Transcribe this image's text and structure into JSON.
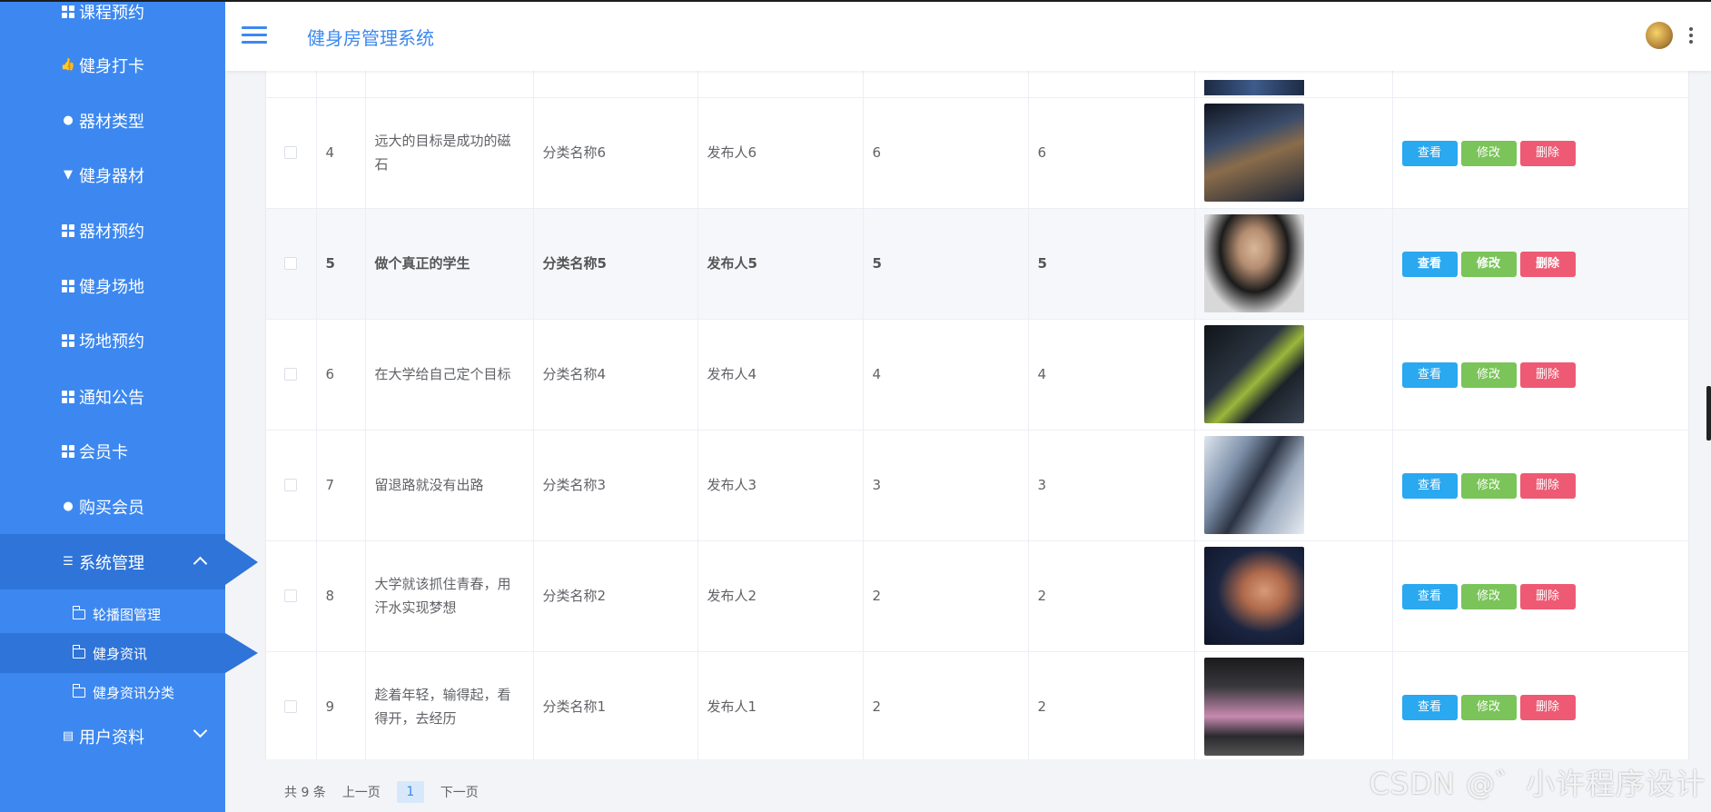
{
  "sidebar": {
    "items": [
      {
        "label": "课程预约",
        "icon": "grid-icon"
      },
      {
        "label": "健身打卡",
        "icon": "thumb-icon"
      },
      {
        "label": "器材类型",
        "icon": "bulb-icon"
      },
      {
        "label": "健身器材",
        "icon": "pin-icon"
      },
      {
        "label": "器材预约",
        "icon": "grid-icon"
      },
      {
        "label": "健身场地",
        "icon": "grid-icon"
      },
      {
        "label": "场地预约",
        "icon": "grid-icon"
      },
      {
        "label": "通知公告",
        "icon": "grid-icon"
      },
      {
        "label": "会员卡",
        "icon": "grid-icon"
      },
      {
        "label": "购买会员",
        "icon": "user-icon"
      },
      {
        "label": "系统管理",
        "icon": "list-icon"
      },
      {
        "label": "用户资料",
        "icon": "card-icon"
      }
    ],
    "sub_items": [
      {
        "label": "轮播图管理",
        "icon": "folder-icon"
      },
      {
        "label": "健身资讯",
        "icon": "folder-icon"
      },
      {
        "label": "健身资讯分类",
        "icon": "folder-icon"
      }
    ]
  },
  "header": {
    "title": "健身房管理系统",
    "menu_icon": "hamburger-icon",
    "avatar_icon": "avatar",
    "more_icon": "more-vertical-icon"
  },
  "table": {
    "rows": [
      {
        "id": "4",
        "title": "远大的目标是成功的磁石",
        "category": "分类名称6",
        "publisher": "发布人6",
        "col5": "6",
        "col6": "6"
      },
      {
        "id": "5",
        "title": "做个真正的学生",
        "category": "分类名称5",
        "publisher": "发布人5",
        "col5": "5",
        "col6": "5"
      },
      {
        "id": "6",
        "title": "在大学给自己定个目标",
        "category": "分类名称4",
        "publisher": "发布人4",
        "col5": "4",
        "col6": "4"
      },
      {
        "id": "7",
        "title": "留退路就没有出路",
        "category": "分类名称3",
        "publisher": "发布人3",
        "col5": "3",
        "col6": "3"
      },
      {
        "id": "8",
        "title": "大学就该抓住青春，用汗水实现梦想",
        "category": "分类名称2",
        "publisher": "发布人2",
        "col5": "2",
        "col6": "2"
      },
      {
        "id": "9",
        "title": "趁着年轻，输得起，看得开，去经历",
        "category": "分类名称1",
        "publisher": "发布人1",
        "col5": "2",
        "col6": "2"
      }
    ],
    "actions": {
      "view": "查看",
      "edit": "修改",
      "delete": "删除"
    }
  },
  "pagination": {
    "total": "共 9 条",
    "prev": "上一页",
    "current": "1",
    "next": "下一页"
  },
  "watermark": "CSDN @゛小许程序设计",
  "colors": {
    "sidebar": "#3d88f0",
    "sidebar_active": "#2f74d8",
    "view_button": "#2aa8f0",
    "edit_button": "#7ac45a",
    "delete_button": "#ee5a73"
  }
}
